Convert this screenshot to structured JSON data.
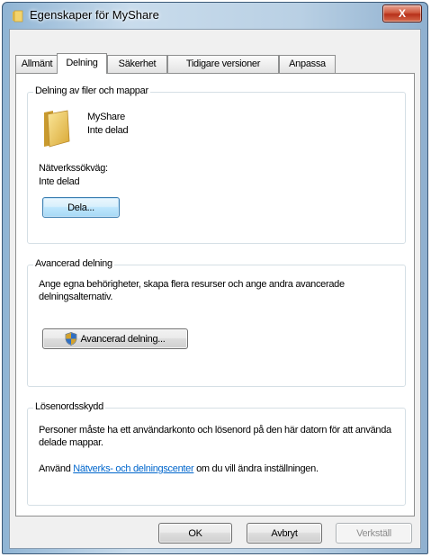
{
  "window": {
    "title": "Egenskaper för MyShare",
    "close_label": "X"
  },
  "tabs": [
    {
      "label": "Allmänt"
    },
    {
      "label": "Delning"
    },
    {
      "label": "Säkerhet"
    },
    {
      "label": "Tidigare versioner"
    },
    {
      "label": "Anpassa"
    }
  ],
  "active_tab": "Delning",
  "sharing": {
    "group_title": "Delning av filer och mappar",
    "folder_name": "MyShare",
    "folder_status": "Inte delad",
    "path_label": "Nätverkssökväg:",
    "path_value": "Inte delad",
    "share_button": "Dela..."
  },
  "advanced": {
    "group_title": "Avancerad delning",
    "description": "Ange egna behörigheter, skapa flera resurser och ange andra avancerade delningsalternativ.",
    "button": "Avancerad delning..."
  },
  "password": {
    "group_title": "Lösenordsskydd",
    "description": "Personer måste ha ett användarkonto och lösenord på den här datorn för att använda delade mappar.",
    "change_prefix": "Använd ",
    "change_link": "Nätverks- och delningscenter",
    "change_suffix": " om du vill ändra inställningen."
  },
  "buttons": {
    "ok": "OK",
    "cancel": "Avbryt",
    "apply": "Verkställ"
  },
  "colors": {
    "link": "#0066cc",
    "close_button": "#c7432a"
  },
  "icons": {
    "title": "folder-icon",
    "folder": "folder-icon",
    "shield": "shield-icon"
  }
}
